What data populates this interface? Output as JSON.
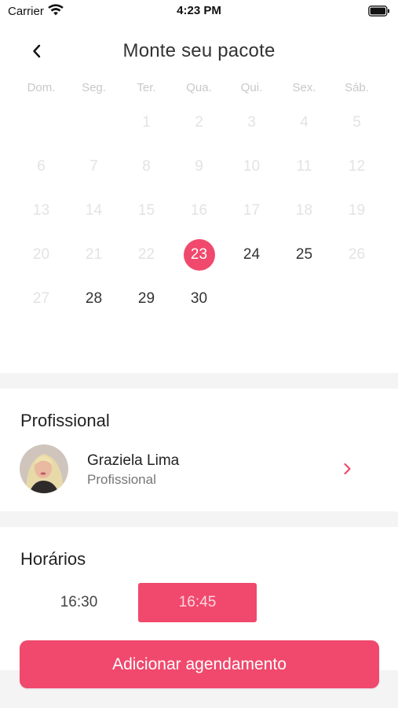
{
  "status_bar": {
    "carrier": "Carrier",
    "time": "4:23 PM"
  },
  "header": {
    "title": "Monte seu pacote"
  },
  "calendar": {
    "weekdays": [
      "Dom.",
      "Seg.",
      "Ter.",
      "Qua.",
      "Qui.",
      "Sex.",
      "Sáb."
    ],
    "days": [
      {
        "label": "",
        "state": "empty"
      },
      {
        "label": "",
        "state": "empty"
      },
      {
        "label": "1",
        "state": "disabled"
      },
      {
        "label": "2",
        "state": "disabled"
      },
      {
        "label": "3",
        "state": "disabled"
      },
      {
        "label": "4",
        "state": "disabled"
      },
      {
        "label": "5",
        "state": "disabled"
      },
      {
        "label": "6",
        "state": "disabled"
      },
      {
        "label": "7",
        "state": "disabled"
      },
      {
        "label": "8",
        "state": "disabled"
      },
      {
        "label": "9",
        "state": "disabled"
      },
      {
        "label": "10",
        "state": "disabled"
      },
      {
        "label": "11",
        "state": "disabled"
      },
      {
        "label": "12",
        "state": "disabled"
      },
      {
        "label": "13",
        "state": "disabled"
      },
      {
        "label": "14",
        "state": "disabled"
      },
      {
        "label": "15",
        "state": "disabled"
      },
      {
        "label": "16",
        "state": "disabled"
      },
      {
        "label": "17",
        "state": "disabled"
      },
      {
        "label": "18",
        "state": "disabled"
      },
      {
        "label": "19",
        "state": "disabled"
      },
      {
        "label": "20",
        "state": "disabled"
      },
      {
        "label": "21",
        "state": "disabled"
      },
      {
        "label": "22",
        "state": "disabled"
      },
      {
        "label": "23",
        "state": "selected"
      },
      {
        "label": "24",
        "state": "active"
      },
      {
        "label": "25",
        "state": "active"
      },
      {
        "label": "26",
        "state": "disabled"
      },
      {
        "label": "27",
        "state": "disabled"
      },
      {
        "label": "28",
        "state": "active"
      },
      {
        "label": "29",
        "state": "active"
      },
      {
        "label": "30",
        "state": "active"
      }
    ]
  },
  "professional": {
    "section_title": "Profissional",
    "name": "Graziela Lima",
    "role": "Profissional"
  },
  "schedule": {
    "section_title": "Horários",
    "slots": [
      {
        "label": "16:30",
        "selected": false
      },
      {
        "label": "16:45",
        "selected": true
      }
    ]
  },
  "cta": {
    "label": "Adicionar agendamento"
  },
  "colors": {
    "accent": "#f0496d",
    "disabled_text": "#e3e3e3",
    "weekday_text": "#c8c8c8",
    "section_bg": "#f4f4f4"
  }
}
